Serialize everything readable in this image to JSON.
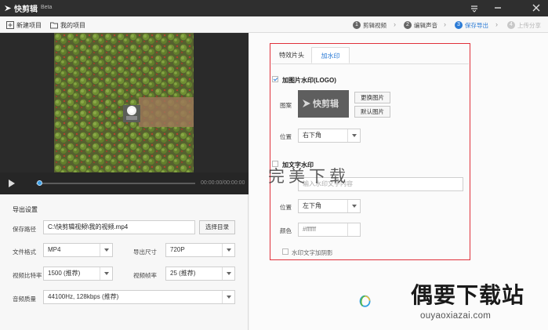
{
  "window": {
    "app_name": "快剪辑",
    "beta": "Beta"
  },
  "toolbar": {
    "new_project": "新建项目",
    "my_projects": "我的项目",
    "steps": [
      {
        "num": "1",
        "label": "剪辑视频"
      },
      {
        "num": "2",
        "label": "编辑声音"
      },
      {
        "num": "3",
        "label": "保存导出"
      },
      {
        "num": "4",
        "label": "上传分享"
      }
    ]
  },
  "player": {
    "time": "00:00:00/00:00:00",
    "progress": 0.0
  },
  "export": {
    "title": "导出设置",
    "save_path_label": "保存路径",
    "save_path_value": "C:\\快剪辑视频\\我的视频.mp4",
    "choose_dir": "选择目录",
    "format_label": "文件格式",
    "format_value": "MP4",
    "size_label": "导出尺寸",
    "size_value": "720P",
    "bitrate_label": "视频比特率",
    "bitrate_value": "1500 (推荐)",
    "framerate_label": "视频帧率",
    "framerate_value": "25 (推荐)",
    "audio_label": "音频质量",
    "audio_value": "44100Hz, 128kbps (推荐)"
  },
  "watermark": {
    "tab_effects": "特效片头",
    "tab_watermark": "加水印",
    "image_wm_label": "加图片水印(LOGO)",
    "image_wm_checked": true,
    "pattern_label": "图案",
    "logo_text": "快剪辑",
    "replace_image": "更换图片",
    "default_image": "默认图片",
    "image_position_label": "位置",
    "image_position_value": "右下角",
    "text_wm_label": "加文字水印",
    "text_wm_checked": false,
    "text_placeholder": "输入水印文字内容",
    "text_position_label": "位置",
    "text_position_value": "左下角",
    "color_label": "颜色",
    "color_value": "#ffffff",
    "shadow_label": "水印文字加阴影",
    "shadow_checked": false
  },
  "overlay": {
    "watermark_text": "完美下载",
    "brand_name": "偶要下载站",
    "brand_url": "ouyaoxiazai.com"
  },
  "colors": {
    "accent": "#2b7bd6",
    "highlight_box": "#e0303a"
  }
}
